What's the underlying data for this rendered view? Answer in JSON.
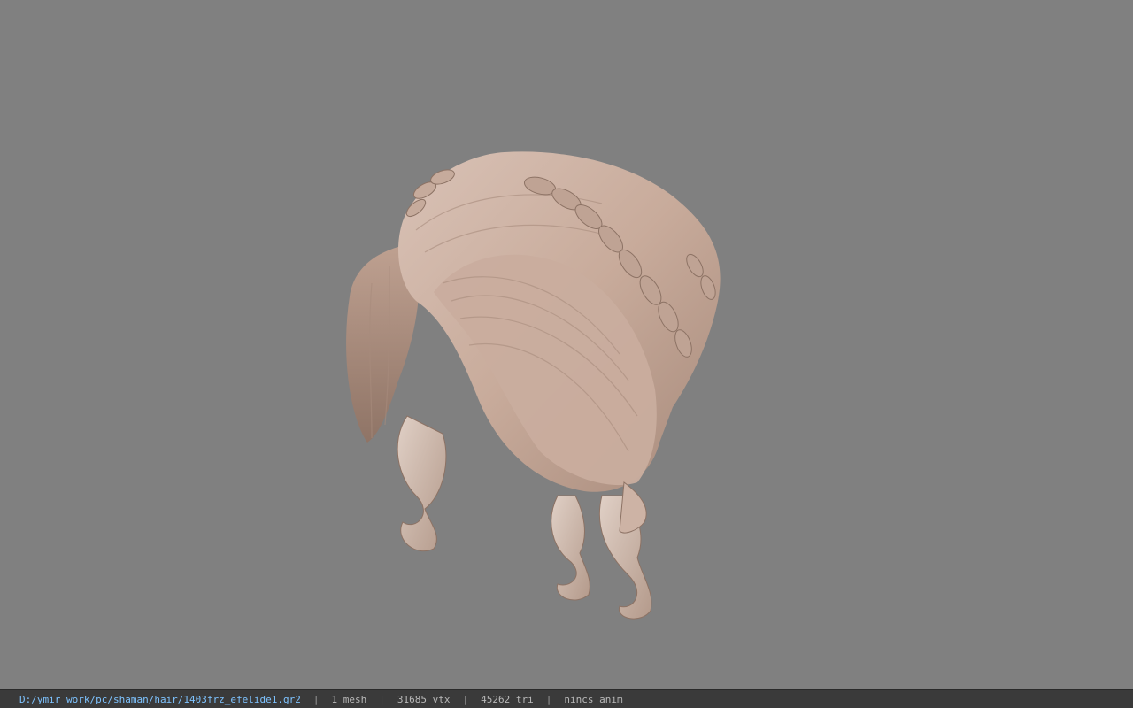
{
  "viewer": {
    "background_color": "#808080",
    "model_subject": "braided hair mesh"
  },
  "statusbar": {
    "file_path": "D:/ymir work/pc/shaman/hair/1403frz_efelide1.gr2",
    "separator": "|",
    "mesh_count": "1 mesh",
    "vertex_count": "31685 vtx",
    "triangle_count": "45262 tri",
    "animation_status": "nincs anim"
  }
}
